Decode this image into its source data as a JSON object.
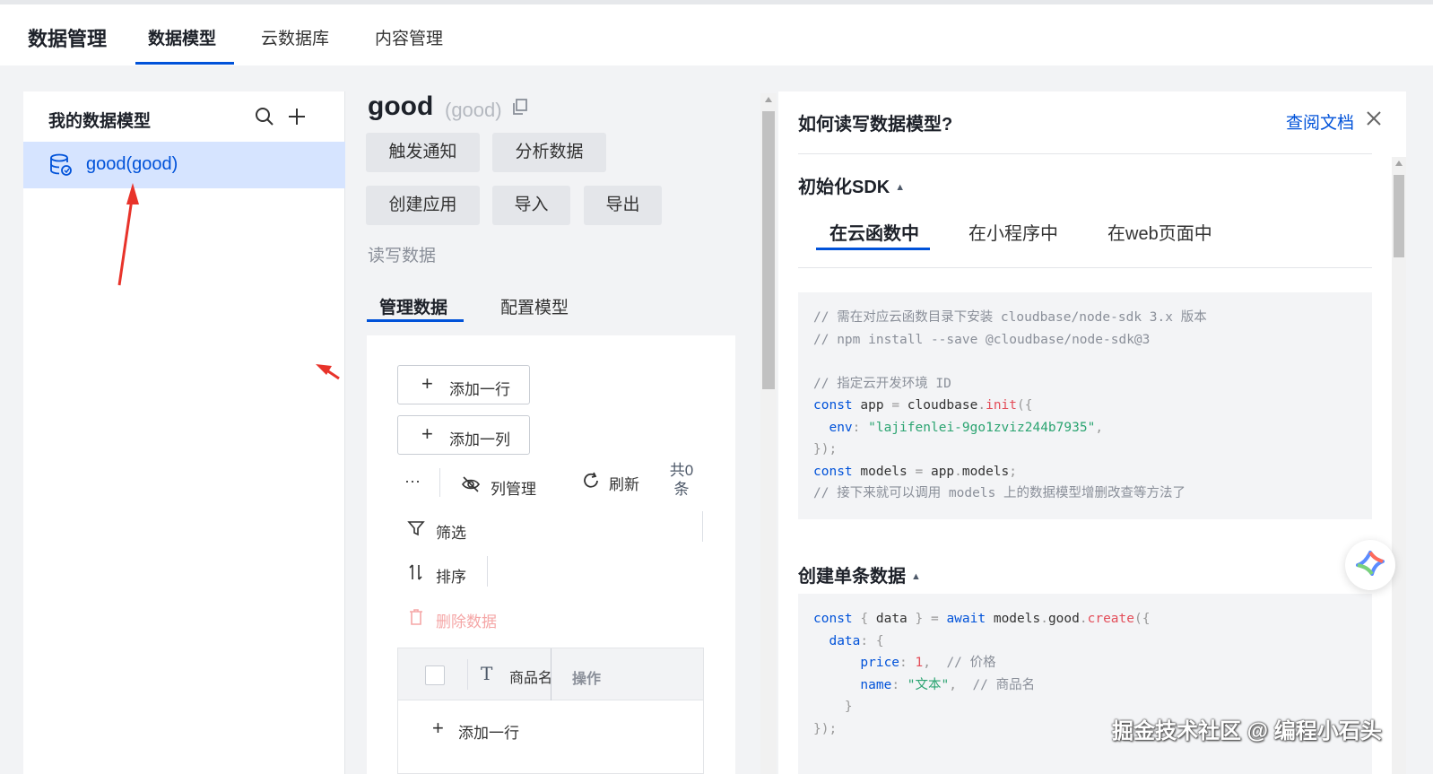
{
  "topnav": {
    "brand": "数据管理",
    "tabs": [
      {
        "label": "数据模型",
        "active": true
      },
      {
        "label": "云数据库",
        "active": false
      },
      {
        "label": "内容管理",
        "active": false
      }
    ]
  },
  "sidebar": {
    "title": "我的数据模型",
    "icons": [
      "search-icon",
      "plus-icon"
    ],
    "items": [
      {
        "label": "good(good)",
        "icon": "database-icon",
        "selected": true
      }
    ]
  },
  "model": {
    "name": "good",
    "id": "(good)",
    "buttons": [
      "触发通知",
      "分析数据",
      "创建应用",
      "导入",
      "导出"
    ],
    "section_label": "读写数据",
    "subtabs": [
      {
        "label": "管理数据",
        "active": true
      },
      {
        "label": "配置模型",
        "active": false
      }
    ]
  },
  "data_panel": {
    "add_row": "添加一行",
    "add_column": "添加一列",
    "more": "···",
    "column_manage": "列管理",
    "refresh": "刷新",
    "count": "共0条",
    "filter": "筛选",
    "sort": "排序",
    "delete": "删除数据",
    "table": {
      "columns": [
        "商品名",
        "操作"
      ],
      "add_row": "添加一行"
    }
  },
  "help_panel": {
    "title": "如何读写数据模型?",
    "doc_link": "查阅文档",
    "sections": [
      {
        "title": "初始化SDK"
      },
      {
        "title": "创建单条数据"
      }
    ],
    "tabs": [
      {
        "label": "在云函数中",
        "active": true
      },
      {
        "label": "在小程序中",
        "active": false
      },
      {
        "label": "在web页面中",
        "active": false
      }
    ],
    "init_code": [
      "// 需在对应云函数目录下安装 cloudbase/node-sdk 3.x 版本",
      "// npm install --save @cloudbase/node-sdk@3",
      "",
      "// 指定云开发环境 ID",
      "const app = cloudbase.init({",
      "  env: \"lajifenlei-9go1zviz244b7935\",",
      "});",
      "const models = app.models;",
      "// 接下来就可以调用 models 上的数据模型增删改查等方法了"
    ],
    "create_code": [
      "const { data } = await models.good.create({",
      "  data: {",
      "      price: 1,  // 价格",
      "      name: \"文本\",  // 商品名",
      "    }",
      "});"
    ]
  },
  "watermark": "掘金技术社区 @ 编程小石头",
  "colors": {
    "accent": "#0052d9",
    "selected_bg": "#d6e4ff",
    "annotation_arrow": "#e8332a",
    "danger_light": "#f5a7a7"
  }
}
